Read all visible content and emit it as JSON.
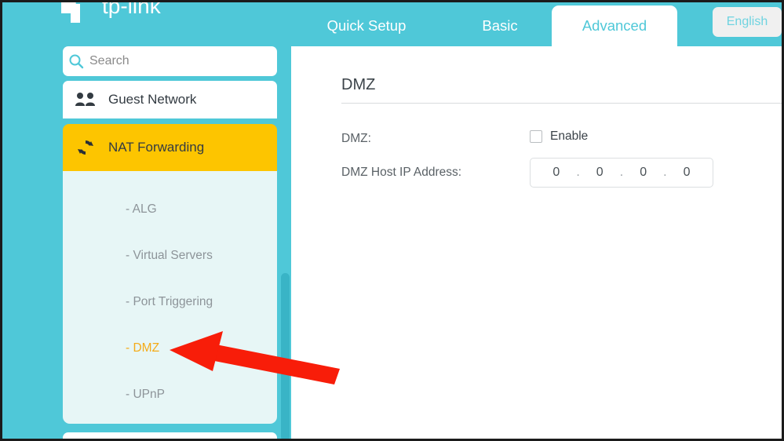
{
  "header": {
    "logo_text": "tp-link",
    "tabs": [
      {
        "label": "Quick Setup",
        "active": false
      },
      {
        "label": "Basic",
        "active": false
      },
      {
        "label": "Advanced",
        "active": true
      }
    ],
    "language_button": "English"
  },
  "sidebar": {
    "search": {
      "placeholder": "Search",
      "value": "",
      "icon": "search-icon"
    },
    "items": [
      {
        "label": "Guest Network",
        "icon": "guest-users-icon",
        "state": "default"
      },
      {
        "label": "NAT Forwarding",
        "icon": "nat-forwarding-icon",
        "state": "expanded"
      }
    ],
    "submenu": [
      {
        "label": "- ALG",
        "active": false
      },
      {
        "label": "- Virtual Servers",
        "active": false
      },
      {
        "label": "- Port Triggering",
        "active": false
      },
      {
        "label": "- DMZ",
        "active": true
      },
      {
        "label": "- UPnP",
        "active": false
      }
    ]
  },
  "main": {
    "title": "DMZ",
    "fields": {
      "dmz": {
        "label": "DMZ:",
        "checkbox_label": "Enable",
        "checked": false
      },
      "dmz_host_ip": {
        "label": "DMZ Host IP Address:",
        "octets": [
          "0",
          "0",
          "0",
          "0"
        ],
        "separator": "."
      }
    }
  },
  "annotation": {
    "type": "arrow",
    "color": "#f81d09",
    "points_to": "- DMZ"
  },
  "colors": {
    "brand_teal": "#4fc8d8",
    "accent_amber": "#fdc500",
    "active_submenu": "#f5ab18",
    "submenu_bg": "#e7f6f6",
    "annotation_red": "#f81d09"
  }
}
